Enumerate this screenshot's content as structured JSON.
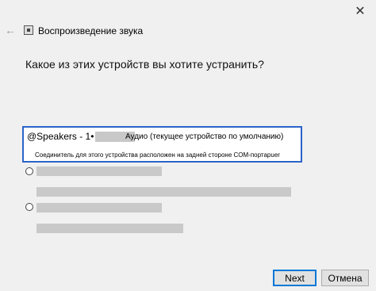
{
  "window": {
    "close_glyph": "✕",
    "title": "Воспроизведение звука",
    "back_glyph": "←"
  },
  "question": "Какое из этих устройств вы хотите устранить?",
  "devices": [
    {
      "name": "@Speakers - 1•",
      "status": "Аудио (текущее устройство по умолчанию)",
      "description": "Соединитель для этого устройства расположен на задней стороне COM-портаpuer"
    }
  ],
  "buttons": {
    "next_label": "Next",
    "cancel_label": "Отмена"
  },
  "colors": {
    "selection_border": "#2b63c9",
    "background": "#f0f0f0"
  }
}
